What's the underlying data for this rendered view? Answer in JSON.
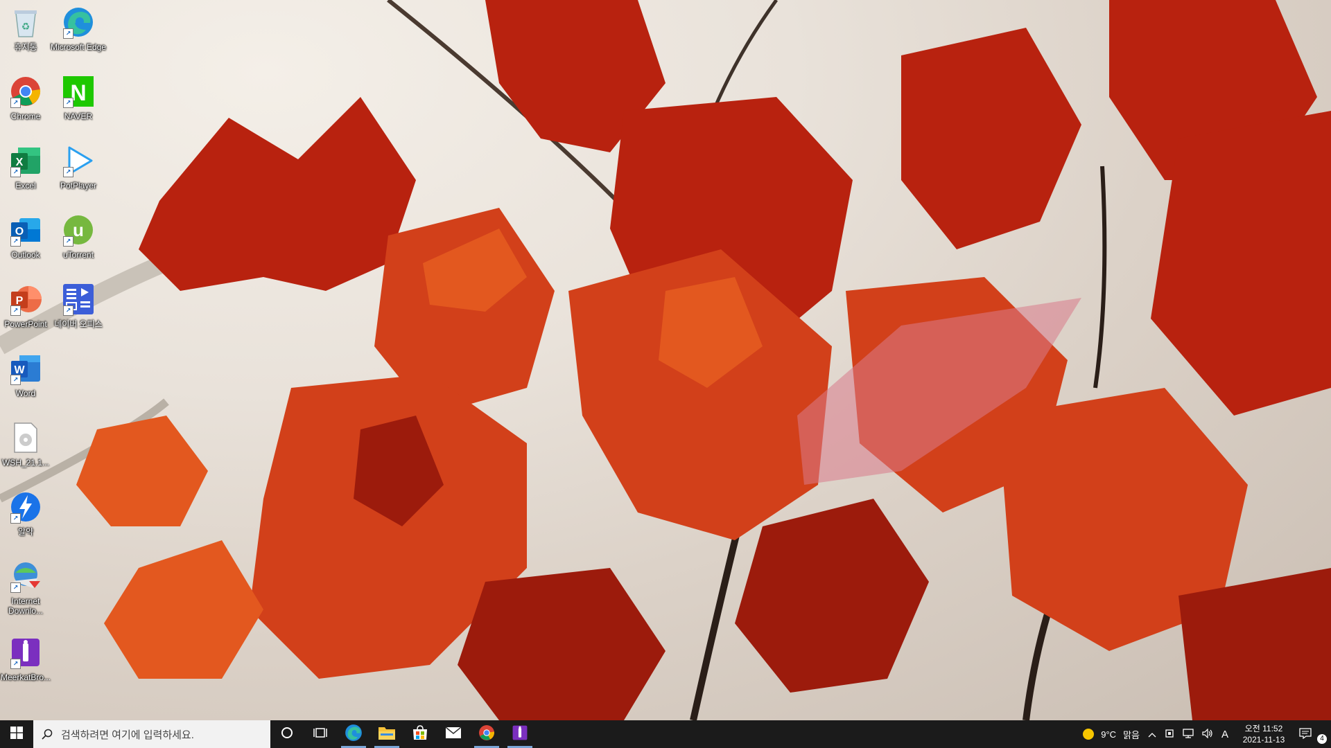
{
  "desktop": {
    "icons": [
      {
        "label": "휴지통",
        "icon": "recycle-bin-icon"
      },
      {
        "label": "Microsoft Edge",
        "icon": "edge-icon"
      },
      {
        "label": "Chrome",
        "icon": "chrome-icon"
      },
      {
        "label": "NAVER",
        "icon": "naver-icon"
      },
      {
        "label": "Excel",
        "icon": "excel-icon"
      },
      {
        "label": "PotPlayer",
        "icon": "potplayer-icon"
      },
      {
        "label": "Outlook",
        "icon": "outlook-icon"
      },
      {
        "label": "uTorrent",
        "icon": "utorrent-icon"
      },
      {
        "label": "PowerPoint",
        "icon": "powerpoint-icon"
      },
      {
        "label": "네이버 오피스",
        "icon": "naver-office-icon"
      },
      {
        "label": "Word",
        "icon": "word-icon"
      },
      {
        "label": "WSH_21.1...",
        "icon": "file-icon"
      },
      {
        "label": "알약",
        "icon": "alyac-icon"
      },
      {
        "label": "Internet Downlo...",
        "icon": "idm-icon"
      },
      {
        "label": "MeerkatBro...",
        "icon": "meerkat-browser-icon"
      }
    ]
  },
  "taskbar": {
    "search_placeholder": "검색하려면 여기에 입력하세요.",
    "apps": [
      "cortana-icon",
      "task-view-icon",
      "edge-icon",
      "file-explorer-icon",
      "store-icon",
      "mail-icon",
      "chrome-icon",
      "meerkat-browser-icon"
    ],
    "weather_temp": "9°C",
    "weather_desc": "맑음",
    "ime": "A",
    "clock_time": "오전 11:52",
    "clock_date": "2021-11-13",
    "notification_count": "4"
  },
  "colors": {
    "taskbar_bg": "#1b1b1b",
    "leaf_red": "#c62a12",
    "leaf_orange": "#e0551c"
  }
}
